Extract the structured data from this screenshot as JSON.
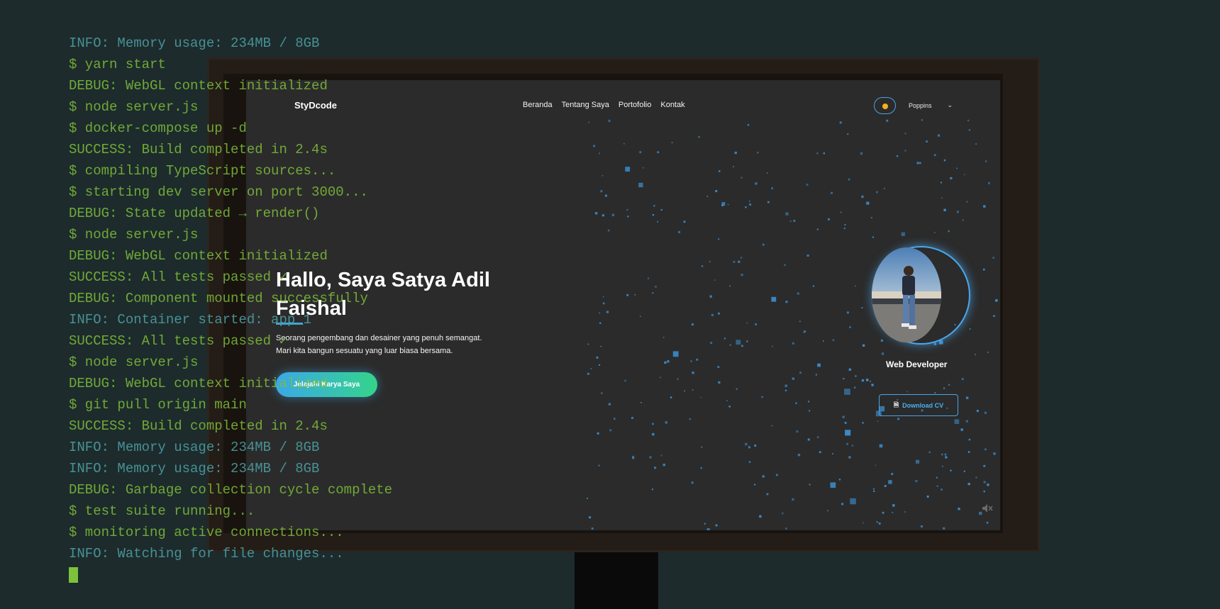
{
  "terminal": {
    "lines": [
      {
        "text": "INFO: Memory usage: 234MB / 8GB",
        "kind": "INFO"
      },
      {
        "text": "$ yarn start",
        "kind": "CMD"
      },
      {
        "text": "DEBUG: WebGL context initialized",
        "kind": "DEBUG"
      },
      {
        "text": "$ node server.js",
        "kind": "CMD"
      },
      {
        "text": "$ docker-compose up -d",
        "kind": "CMD"
      },
      {
        "text": "SUCCESS: Build completed in 2.4s",
        "kind": "SUCCESS"
      },
      {
        "text": "$ compiling TypeScript sources...",
        "kind": "CMD"
      },
      {
        "text": "$ starting dev server on port 3000...",
        "kind": "CMD"
      },
      {
        "text": "DEBUG: State updated → render()",
        "kind": "DEBUG"
      },
      {
        "text": "$ node server.js",
        "kind": "CMD"
      },
      {
        "text": "DEBUG: WebGL context initialized",
        "kind": "DEBUG"
      },
      {
        "text": "SUCCESS: All tests passed ✓",
        "kind": "SUCCESS"
      },
      {
        "text": "DEBUG: Component mounted successfully",
        "kind": "DEBUG"
      },
      {
        "text": "INFO: Container started: app_1",
        "kind": "INFO"
      },
      {
        "text": "SUCCESS: All tests passed ✓",
        "kind": "SUCCESS"
      },
      {
        "text": "$ node server.js",
        "kind": "CMD"
      },
      {
        "text": "DEBUG: WebGL context initialized",
        "kind": "DEBUG"
      },
      {
        "text": "$ git pull origin main",
        "kind": "CMD"
      },
      {
        "text": "SUCCESS: Build completed in 2.4s",
        "kind": "SUCCESS"
      },
      {
        "text": "INFO: Memory usage: 234MB / 8GB",
        "kind": "INFO"
      },
      {
        "text": "INFO: Memory usage: 234MB / 8GB",
        "kind": "INFO"
      },
      {
        "text": "DEBUG: Garbage collection cycle complete",
        "kind": "DEBUG"
      },
      {
        "text": "$ test suite running...",
        "kind": "CMD"
      },
      {
        "text": "$ monitoring active connections...",
        "kind": "CMD"
      },
      {
        "text": "INFO: Watching for file changes...",
        "kind": "INFO"
      }
    ]
  },
  "site": {
    "logo": "StyDcode",
    "nav": [
      "Beranda",
      "Tentang Saya",
      "Portofolio",
      "Kontak"
    ],
    "font_select": "Poppins",
    "hero": {
      "title": "Hallo, Saya Satya Adil Faishal",
      "subtitle_line1": "Seorang pengembang dan desainer yang penuh semangat.",
      "subtitle_line2": "Mari kita bangun sesuatu yang luar biasa bersama.",
      "cta": "Jelajahi Karya Saya"
    },
    "profile": {
      "role": "Web Developer",
      "download": "Download CV"
    },
    "icons": {
      "theme": "sun-icon",
      "download": "document-icon",
      "sound": "speaker-mute-icon"
    }
  },
  "colors": {
    "background": "#1d2b2c",
    "screen": "#2b2b2b",
    "accent_blue": "#4aa3e6",
    "accent_green": "#34d48a",
    "particle": "#3b8fd0",
    "terminal_green": "#7fbf3a",
    "terminal_teal": "#4fa3a8"
  }
}
